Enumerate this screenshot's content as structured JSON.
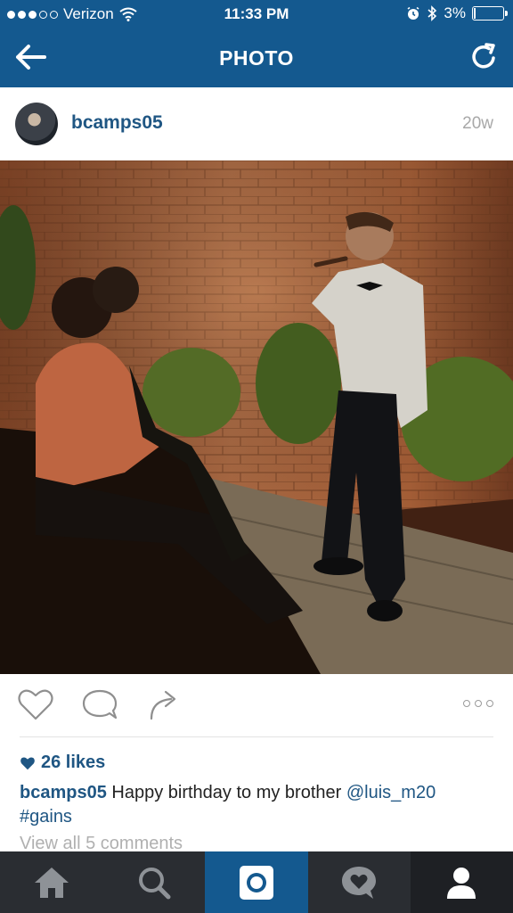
{
  "status_bar": {
    "carrier": "Verizon",
    "time": "11:33 PM",
    "battery": "3%",
    "battery_fraction": 0.03
  },
  "header": {
    "title": "PHOTO"
  },
  "post": {
    "username": "bcamps05",
    "age": "20w",
    "likes": "26 likes",
    "caption_user": "bcamps05",
    "caption_text": " Happy birthday to my brother ",
    "caption_mention": "@luis_m20",
    "caption_hashtag": "#gains",
    "view_comments": "View all 5 comments"
  },
  "tabs": [
    {
      "name": "home"
    },
    {
      "name": "explore"
    },
    {
      "name": "camera",
      "active": true
    },
    {
      "name": "activity"
    },
    {
      "name": "profile"
    }
  ],
  "colors": {
    "brand_blue": "#14598f",
    "link_blue": "#1f5683",
    "tab_bg": "#2a2d32"
  }
}
